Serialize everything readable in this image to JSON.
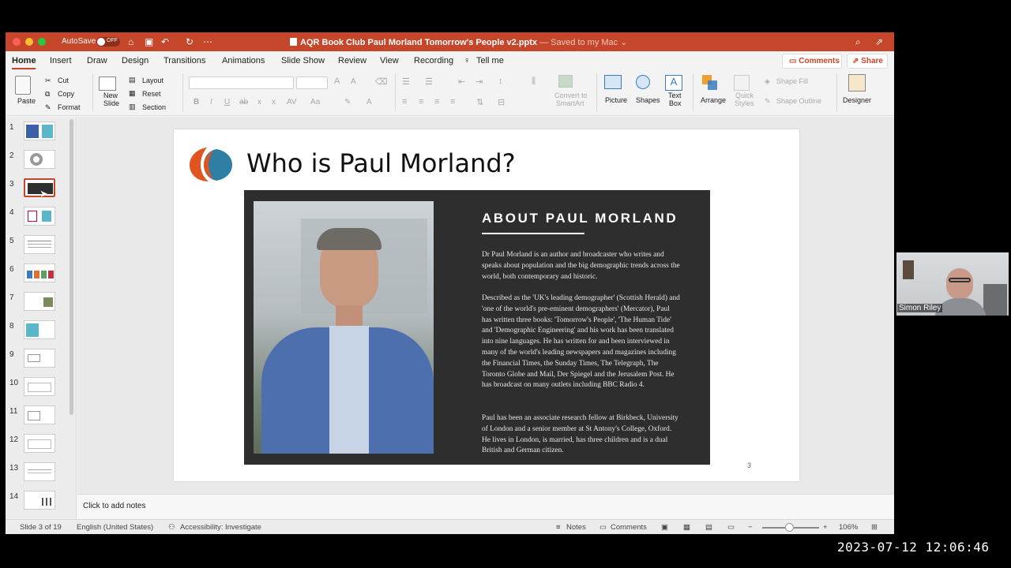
{
  "window": {
    "autosave_label": "AutoSave",
    "autosave_state": "OFF",
    "doc_title": "AQR Book Club Paul Morland Tomorrow's People v2.pptx",
    "saved_status": " — Saved to my Mac ⌄"
  },
  "tabs": [
    "Home",
    "Insert",
    "Draw",
    "Design",
    "Transitions",
    "Animations",
    "Slide Show",
    "Review",
    "View",
    "Recording",
    "Tell me"
  ],
  "header_buttons": {
    "comments": "Comments",
    "share": "Share"
  },
  "ribbon": {
    "paste": "Paste",
    "cut": "Cut",
    "copy": "Copy",
    "format": "Format",
    "new_slide_line1": "New",
    "new_slide_line2": "Slide",
    "layout": "Layout",
    "reset": "Reset",
    "section": "Section",
    "convert_line1": "Convert to",
    "convert_line2": "SmartArt",
    "picture": "Picture",
    "shapes": "Shapes",
    "textbox_line1": "Text",
    "textbox_line2": "Box",
    "arrange": "Arrange",
    "quick_styles_line1": "Quick",
    "quick_styles_line2": "Styles",
    "shape_fill": "Shape Fill",
    "shape_outline": "Shape Outline",
    "designer": "Designer"
  },
  "thumbnails": [
    "1",
    "2",
    "3",
    "4",
    "5",
    "6",
    "7",
    "8",
    "9",
    "10",
    "11",
    "12",
    "13",
    "14"
  ],
  "selected_slide": 3,
  "slide": {
    "title": "Who is Paul Morland?",
    "number": "3",
    "about_heading": "ABOUT PAUL MORLAND",
    "paragraphs": [
      "Dr Paul Morland is an author and broadcaster who writes and speaks about population and the big demographic trends across the world, both contemporary and historic.",
      "Described as the 'UK's leading demographer' (Scottish Herald) and 'one of the world's pre-eminent demographers' (Mercator), Paul has written three books: 'Tomorrow's People', 'The Human Tide' and 'Demographic Engineering' and his work has been translated into nine languages.  He has written for and been interviewed in many of the world's leading newspapers and magazines including the Financial Times, the Sunday Times, The Telegraph, The Toronto Globe and Mail, Der Spiegel and the Jerusalem Post. He has broadcast on many outlets including BBC Radio 4.",
      "Paul has been an associate research fellow at Birkbeck, University of London and a senior member at St Antony's College, Oxford. He lives in London, is married, has three children and is a dual British and German citizen."
    ]
  },
  "notes_placeholder": "Click to add notes",
  "status": {
    "slide_of": "Slide 3 of 19",
    "language": "English (United States)",
    "accessibility": "Accessibility: Investigate",
    "notes": "Notes",
    "comments": "Comments",
    "zoom": "106%"
  },
  "webcam": {
    "name": "Simon Riley"
  },
  "timestamp": "2023-07-12 12:06:46",
  "colors": {
    "titlebar": "#c5462b",
    "accent": "#c5462b",
    "about_box": "#2e2e2e"
  }
}
